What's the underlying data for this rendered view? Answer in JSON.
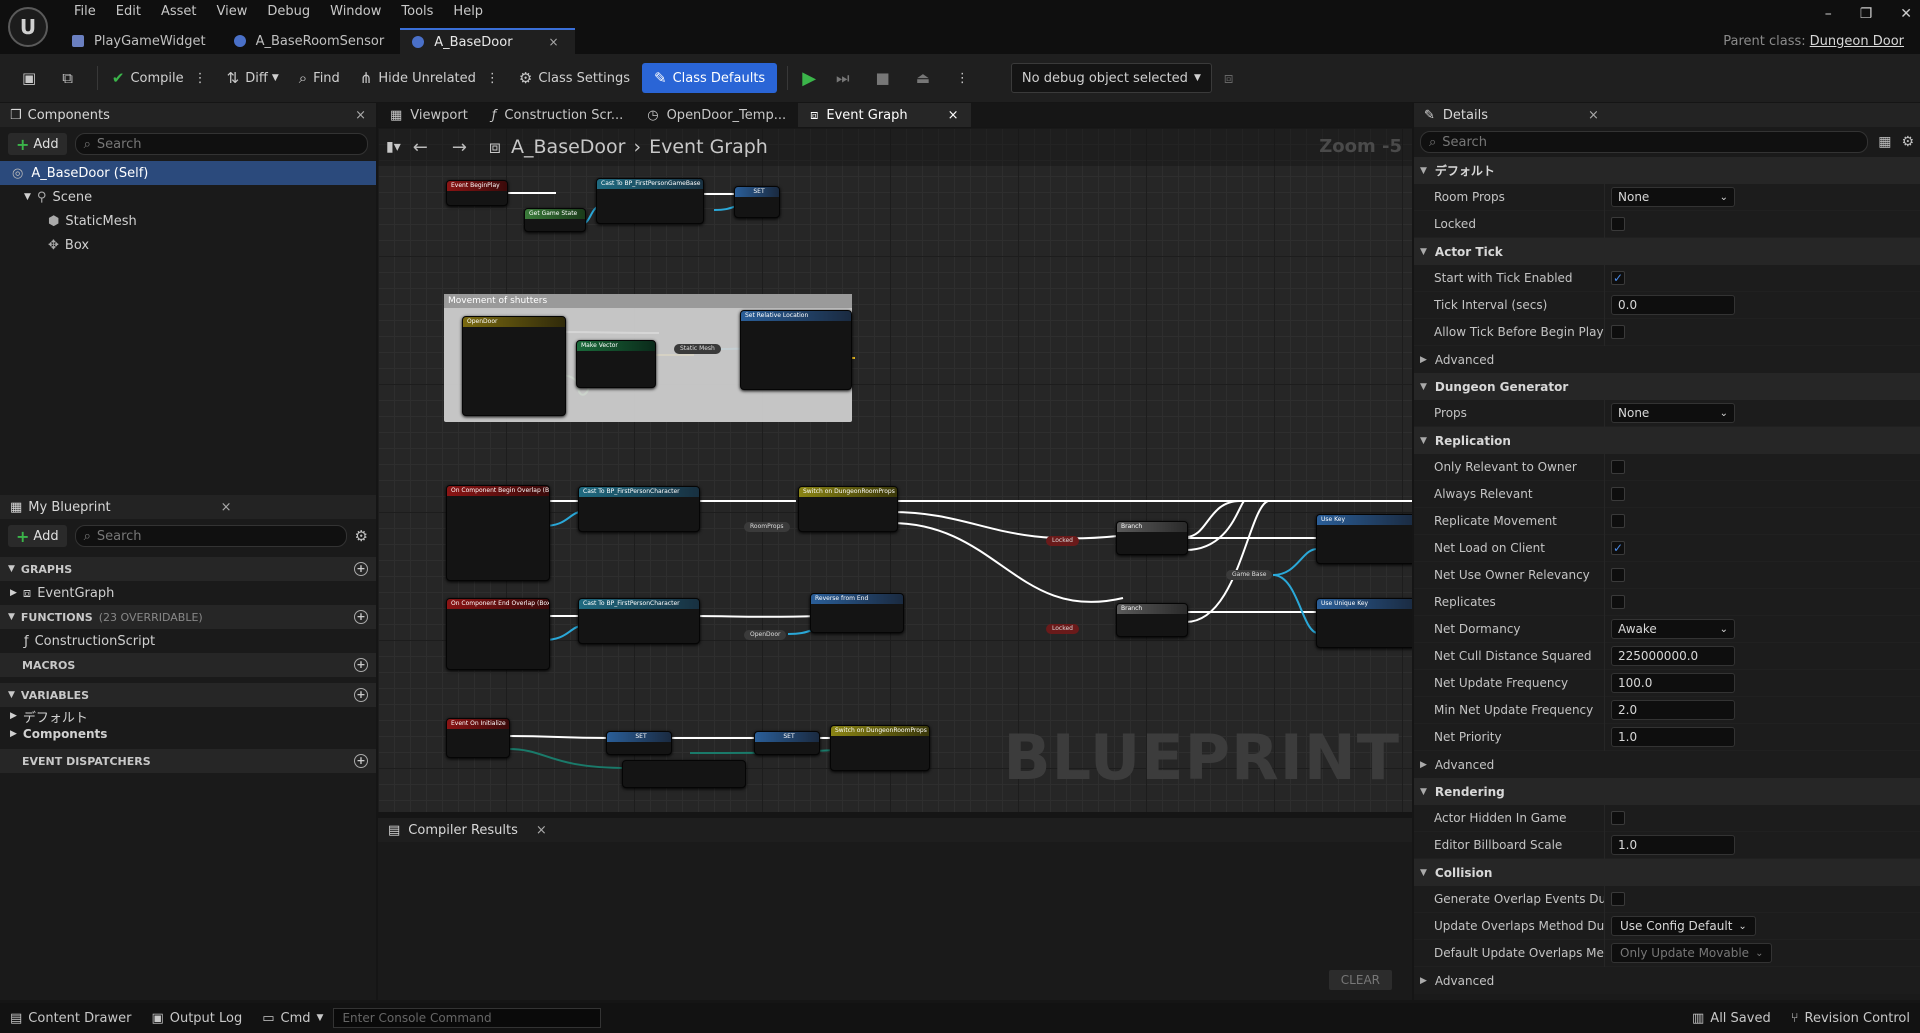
{
  "app": {
    "logo": "U"
  },
  "menu": [
    "File",
    "Edit",
    "Asset",
    "View",
    "Debug",
    "Window",
    "Tools",
    "Help"
  ],
  "doc_tabs": [
    {
      "label": "PlayGameWidget",
      "icon": "widget-icon"
    },
    {
      "label": "A_BaseRoomSensor",
      "icon": "blueprint-icon"
    },
    {
      "label": "A_BaseDoor",
      "icon": "blueprint-icon",
      "close": "×"
    }
  ],
  "window_controls": {
    "minimize": "–",
    "restore": "❐",
    "close": "✕"
  },
  "parent_class": {
    "label": "Parent class:",
    "value": "Dungeon Door"
  },
  "toolbar": {
    "compile": "Compile",
    "diff": "Diff",
    "find": "Find",
    "hide_unrelated": "Hide Unrelated",
    "class_settings": "Class Settings",
    "class_defaults": "Class Defaults",
    "debug_object": "No debug object selected"
  },
  "components": {
    "title": "Components",
    "add": "Add",
    "search_placeholder": "Search",
    "items": [
      {
        "label": "A_BaseDoor (Self)"
      },
      {
        "label": "Scene"
      },
      {
        "label": "StaticMesh"
      },
      {
        "label": "Box"
      }
    ]
  },
  "my_blueprint": {
    "title": "My Blueprint",
    "add": "Add",
    "search_placeholder": "Search",
    "graphs": "GRAPHS",
    "event_graph": "EventGraph",
    "functions": "FUNCTIONS",
    "functions_count": "(23 OVERRIDABLE)",
    "construction_script": "ConstructionScript",
    "macros": "MACROS",
    "variables": "VARIABLES",
    "var_default": "デフォルト",
    "var_components": "Components",
    "event_dispatchers": "EVENT DISPATCHERS"
  },
  "graph_tabs": [
    "Viewport",
    "Construction Scr...",
    "OpenDoor_Temp...",
    "Event Graph"
  ],
  "graph": {
    "breadcrumb_root": "A_BaseDoor",
    "breadcrumb_leaf": "Event Graph",
    "zoom": "Zoom -5",
    "watermark": "BLUEPRINT",
    "comment_title": "Movement of shutters",
    "nodes": {
      "begin_play": "Event BeginPlay",
      "cast_game_base": "Cast To BP_FirstPersonGameBase",
      "get_game_state": "Get Game State",
      "set_game_base": "SET",
      "open_door": "OpenDoor",
      "make_vector": "Make Vector",
      "set_rel_loc": "Set Relative Location",
      "begin_overlap": "On Component Begin Overlap (Box)",
      "cast_character_1": "Cast To BP_FirstPersonCharacter",
      "switch_props_1": "Switch on DungeonRoomProps",
      "branch_1": "Branch",
      "branch_2": "Branch",
      "use_key": "Use Key",
      "use_unique_key": "Use Unique Key",
      "end_overlap": "On Component End Overlap (Box)",
      "cast_character_2": "Cast To BP_FirstPersonCharacter",
      "reverse_from_end": "Reverse from End",
      "initialize": "Event On Initialize",
      "set_1": "SET",
      "set_2": "SET",
      "switch_props_2": "Switch on DungeonRoomProps",
      "locked_1": "Locked",
      "locked_2": "Locked",
      "room_props": "RoomProps",
      "open_door_var": "OpenDoor",
      "game_base": "Game Base",
      "static_mesh": "Static Mesh"
    }
  },
  "compiler": {
    "title": "Compiler Results",
    "clear": "CLEAR"
  },
  "details": {
    "title": "Details",
    "search_placeholder": "Search",
    "sections": [
      {
        "type": "section",
        "label": "デフォルト"
      },
      {
        "type": "select",
        "label": "Room Props",
        "value": "None"
      },
      {
        "type": "check",
        "label": "Locked",
        "checked": false
      },
      {
        "type": "section",
        "label": "Actor Tick"
      },
      {
        "type": "check",
        "label": "Start with Tick Enabled",
        "checked": true
      },
      {
        "type": "number",
        "label": "Tick Interval (secs)",
        "value": "0.0"
      },
      {
        "type": "check",
        "label": "Allow Tick Before Begin Play",
        "checked": false
      },
      {
        "type": "sub",
        "label": "Advanced"
      },
      {
        "type": "section",
        "label": "Dungeon Generator"
      },
      {
        "type": "select",
        "label": "Props",
        "value": "None"
      },
      {
        "type": "section",
        "label": "Replication"
      },
      {
        "type": "check",
        "label": "Only Relevant to Owner",
        "checked": false
      },
      {
        "type": "check",
        "label": "Always Relevant",
        "checked": false
      },
      {
        "type": "check",
        "label": "Replicate Movement",
        "checked": false
      },
      {
        "type": "check",
        "label": "Net Load on Client",
        "checked": true
      },
      {
        "type": "check",
        "label": "Net Use Owner Relevancy",
        "checked": false
      },
      {
        "type": "check",
        "label": "Replicates",
        "checked": false
      },
      {
        "type": "select",
        "label": "Net Dormancy",
        "value": "Awake"
      },
      {
        "type": "number",
        "label": "Net Cull Distance Squared",
        "value": "225000000.0"
      },
      {
        "type": "number",
        "label": "Net Update Frequency",
        "value": "100.0"
      },
      {
        "type": "number",
        "label": "Min Net Update Frequency",
        "value": "2.0"
      },
      {
        "type": "number",
        "label": "Net Priority",
        "value": "1.0"
      },
      {
        "type": "sub",
        "label": "Advanced"
      },
      {
        "type": "section",
        "label": "Rendering"
      },
      {
        "type": "check",
        "label": "Actor Hidden In Game",
        "checked": false
      },
      {
        "type": "number",
        "label": "Editor Billboard Scale",
        "value": "1.0"
      },
      {
        "type": "section",
        "label": "Collision"
      },
      {
        "type": "check",
        "label": "Generate Overlap Events During...",
        "checked": false
      },
      {
        "type": "button",
        "label": "Update Overlaps Method During...",
        "value": "Use Config Default"
      },
      {
        "type": "button-dim",
        "label": "Default Update Overlaps Method...",
        "value": "Only Update Movable"
      },
      {
        "type": "sub",
        "label": "Advanced"
      }
    ]
  },
  "statusbar": {
    "content_drawer": "Content Drawer",
    "output_log": "Output Log",
    "cmd": "Cmd",
    "console_placeholder": "Enter Console Command",
    "all_saved": "All Saved",
    "revision_control": "Revision Control"
  },
  "colors": {
    "accent": "#2a65d6",
    "exec_wire": "#ffffff",
    "vector_wire": "#f0c020",
    "object_wire": "#2aa8d8"
  }
}
